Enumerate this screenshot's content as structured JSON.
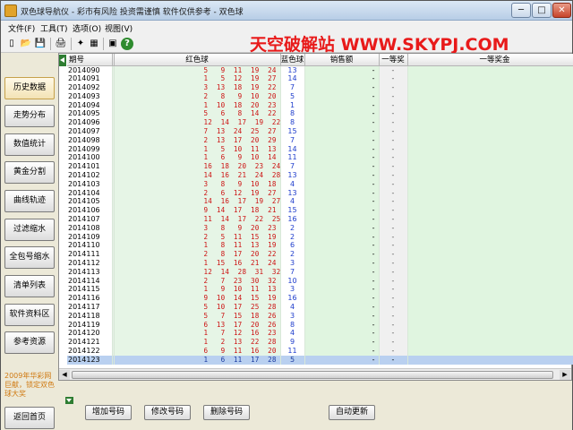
{
  "window": {
    "title": "双色球导航仪 - 彩市有风险 投资需谨慎 软件仅供参考 - 双色球",
    "minimize": "─",
    "maximize": "□",
    "close": "✕"
  },
  "menu": [
    {
      "label": "文件(F)"
    },
    {
      "label": "工具(T)"
    },
    {
      "label": "选项(O)"
    },
    {
      "label": "视图(V)"
    }
  ],
  "toolbar": {
    "icons": [
      "new-file-icon",
      "open-folder-icon",
      "save-icon",
      "print-icon",
      "wand-icon",
      "calculator-icon",
      "window-icon",
      "help-icon"
    ],
    "glyphs": [
      "▯",
      "📂",
      "💾",
      "🖨",
      "✦",
      "▦",
      "▣",
      "?"
    ]
  },
  "banner": {
    "text": "天空破解站 WWW.SKYPJ.COM",
    "color": "#e81a1a"
  },
  "sidebar": {
    "items": [
      {
        "label": "历史数据",
        "active": true
      },
      {
        "label": "走势分布"
      },
      {
        "label": "数值统计"
      },
      {
        "label": "黄金分割"
      },
      {
        "label": "曲线轨迹"
      },
      {
        "label": "过滤缩水"
      },
      {
        "label": "全包号缩水"
      },
      {
        "label": "清单列表"
      },
      {
        "label": "软件资料区"
      },
      {
        "label": "参考资源"
      }
    ],
    "note": "2009年华彩网巨献，锁定双色球大奖",
    "home": "返回首页"
  },
  "table": {
    "headers": {
      "period": "期号",
      "red": "红色球",
      "blue": "蓝色球",
      "sales": "销售额",
      "first": "一等奖",
      "prize": "一等奖金"
    },
    "rows": [
      {
        "period": "2014090",
        "red": "5   9  11  19  24  32",
        "blue": "13",
        "sales": "-",
        "first": "-",
        "prize": "-"
      },
      {
        "period": "2014091",
        "red": "1   5  12  19  27  29",
        "blue": "14",
        "sales": "-",
        "first": "-",
        "prize": "-"
      },
      {
        "period": "2014092",
        "red": "3  13  18  19  22  26",
        "blue": "7",
        "sales": "-",
        "first": "-",
        "prize": "-"
      },
      {
        "period": "2014093",
        "red": "2   8   9  10  20  29",
        "blue": "5",
        "sales": "-",
        "first": "-",
        "prize": "-"
      },
      {
        "period": "2014094",
        "red": "1  10  18  20  23  29",
        "blue": "1",
        "sales": "-",
        "first": "-",
        "prize": "-"
      },
      {
        "period": "2014095",
        "red": "5   6   8  14  22  31",
        "blue": "8",
        "sales": "-",
        "first": "-",
        "prize": "-"
      },
      {
        "period": "2014096",
        "red": "12  14  17  19  22  24",
        "blue": "8",
        "sales": "-",
        "first": "-",
        "prize": "-"
      },
      {
        "period": "2014097",
        "red": "7  13  24  25  27  32",
        "blue": "15",
        "sales": "-",
        "first": "-",
        "prize": "-"
      },
      {
        "period": "2014098",
        "red": "2  13  17  20  29  31",
        "blue": "7",
        "sales": "-",
        "first": "-",
        "prize": "-"
      },
      {
        "period": "2014099",
        "red": "1   5  10  11  13  32",
        "blue": "14",
        "sales": "-",
        "first": "-",
        "prize": "-"
      },
      {
        "period": "2014100",
        "red": "1   6   9  10  14  16",
        "blue": "11",
        "sales": "-",
        "first": "-",
        "prize": "-"
      },
      {
        "period": "2014101",
        "red": "16  18  20  23  24  32",
        "blue": "7",
        "sales": "-",
        "first": "-",
        "prize": "-"
      },
      {
        "period": "2014102",
        "red": "14  16  21  24  28  31",
        "blue": "13",
        "sales": "-",
        "first": "-",
        "prize": "-"
      },
      {
        "period": "2014103",
        "red": "3   8   9  10  18  33",
        "blue": "4",
        "sales": "-",
        "first": "-",
        "prize": "-"
      },
      {
        "period": "2014104",
        "red": "2   6  12  19  27  28",
        "blue": "13",
        "sales": "-",
        "first": "-",
        "prize": "-"
      },
      {
        "period": "2014105",
        "red": "14  16  17  19  27  32",
        "blue": "4",
        "sales": "-",
        "first": "-",
        "prize": "-"
      },
      {
        "period": "2014106",
        "red": "9  14  17  18  21  25",
        "blue": "15",
        "sales": "-",
        "first": "-",
        "prize": "-"
      },
      {
        "period": "2014107",
        "red": "11  14  17  22  25  27",
        "blue": "16",
        "sales": "-",
        "first": "-",
        "prize": "-"
      },
      {
        "period": "2014108",
        "red": "3   8   9  20  23  28",
        "blue": "2",
        "sales": "-",
        "first": "-",
        "prize": "-"
      },
      {
        "period": "2014109",
        "red": "2   5  11  15  19  28",
        "blue": "2",
        "sales": "-",
        "first": "-",
        "prize": "-"
      },
      {
        "period": "2014110",
        "red": "1   8  11  13  19  30",
        "blue": "6",
        "sales": "-",
        "first": "-",
        "prize": "-"
      },
      {
        "period": "2014111",
        "red": "2   8  17  20  22  28",
        "blue": "2",
        "sales": "-",
        "first": "-",
        "prize": "-"
      },
      {
        "period": "2014112",
        "red": "1  15  16  21  24  30",
        "blue": "3",
        "sales": "-",
        "first": "-",
        "prize": "-"
      },
      {
        "period": "2014113",
        "red": "12  14  28  31  32  33",
        "blue": "7",
        "sales": "-",
        "first": "-",
        "prize": "-"
      },
      {
        "period": "2014114",
        "red": "2   7  23  30  32  33",
        "blue": "10",
        "sales": "-",
        "first": "-",
        "prize": "-"
      },
      {
        "period": "2014115",
        "red": "1   9  10  11  13  32",
        "blue": "3",
        "sales": "-",
        "first": "-",
        "prize": "-"
      },
      {
        "period": "2014116",
        "red": "9  10  14  15  19  29",
        "blue": "16",
        "sales": "-",
        "first": "-",
        "prize": "-"
      },
      {
        "period": "2014117",
        "red": "5  10  17  25  28  29",
        "blue": "4",
        "sales": "-",
        "first": "-",
        "prize": "-"
      },
      {
        "period": "2014118",
        "red": "5   7  15  18  26  30",
        "blue": "3",
        "sales": "-",
        "first": "-",
        "prize": "-"
      },
      {
        "period": "2014119",
        "red": "6  13  17  20  26  29",
        "blue": "8",
        "sales": "-",
        "first": "-",
        "prize": "-"
      },
      {
        "period": "2014120",
        "red": "1   7  12  16  23  28",
        "blue": "4",
        "sales": "-",
        "first": "-",
        "prize": "-"
      },
      {
        "period": "2014121",
        "red": "1   2  13  22  28  30",
        "blue": "9",
        "sales": "-",
        "first": "-",
        "prize": "-"
      },
      {
        "period": "2014122",
        "red": "6   9  11  16  20  29",
        "blue": "11",
        "sales": "-",
        "first": "-",
        "prize": "-"
      },
      {
        "period": "2014123",
        "red": "1   6  11  17  28  33",
        "blue": "5",
        "sales": "-",
        "first": "-",
        "prize": "-",
        "selected": true
      }
    ]
  },
  "bottom": {
    "buttons": [
      {
        "label": "增加号码"
      },
      {
        "label": "修改号码"
      },
      {
        "label": "删除号码"
      },
      {
        "label": "自动更新"
      }
    ]
  }
}
